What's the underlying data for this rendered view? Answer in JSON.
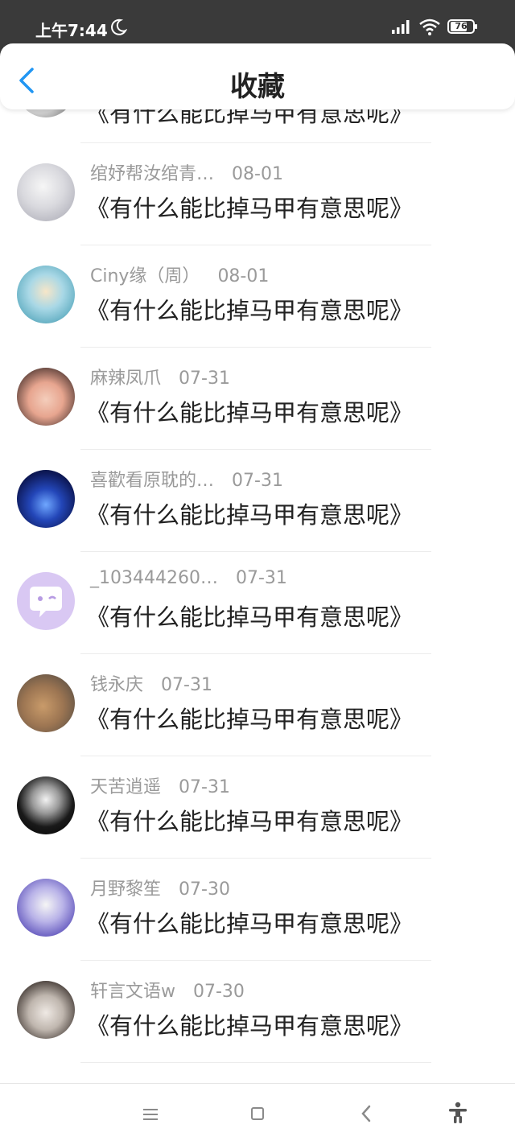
{
  "status_bar": {
    "time": "上午7:44",
    "battery": "76",
    "battery_level": 0.76
  },
  "header": {
    "title": "收藏"
  },
  "partial_item": {
    "title": "《有什么能比掉马甲有意思呢》"
  },
  "items": [
    {
      "name": "绾妤帮汝绾青…",
      "date": "08-01",
      "title": "《有什么能比掉马甲有意思呢》"
    },
    {
      "name": "Ciny缘（周）",
      "date": "08-01",
      "title": "《有什么能比掉马甲有意思呢》"
    },
    {
      "name": "麻辣凤爪",
      "date": "07-31",
      "title": "《有什么能比掉马甲有意思呢》"
    },
    {
      "name": "喜歡看原耽的…",
      "date": "07-31",
      "title": "《有什么能比掉马甲有意思呢》"
    },
    {
      "name": "_103444260…",
      "date": "07-31",
      "title": "《有什么能比掉马甲有意思呢》"
    },
    {
      "name": "钱永庆",
      "date": "07-31",
      "title": "《有什么能比掉马甲有意思呢》"
    },
    {
      "name": "天苦逍遥",
      "date": "07-31",
      "title": "《有什么能比掉马甲有意思呢》"
    },
    {
      "name": "月野黎笙",
      "date": "07-30",
      "title": "《有什么能比掉马甲有意思呢》"
    },
    {
      "name": "轩言文语w",
      "date": "07-30",
      "title": "《有什么能比掉马甲有意思呢》"
    }
  ],
  "colors": {
    "accent": "#2196F3",
    "status_bar": "#3a3a3a",
    "meta_text": "#9a9a9a",
    "title_text": "#222222"
  },
  "icons": [
    "moon-icon",
    "signal-icon",
    "wifi-icon",
    "battery-icon",
    "back-arrow-icon",
    "menu-icon",
    "home-icon",
    "nav-back-icon",
    "accessibility-icon"
  ]
}
